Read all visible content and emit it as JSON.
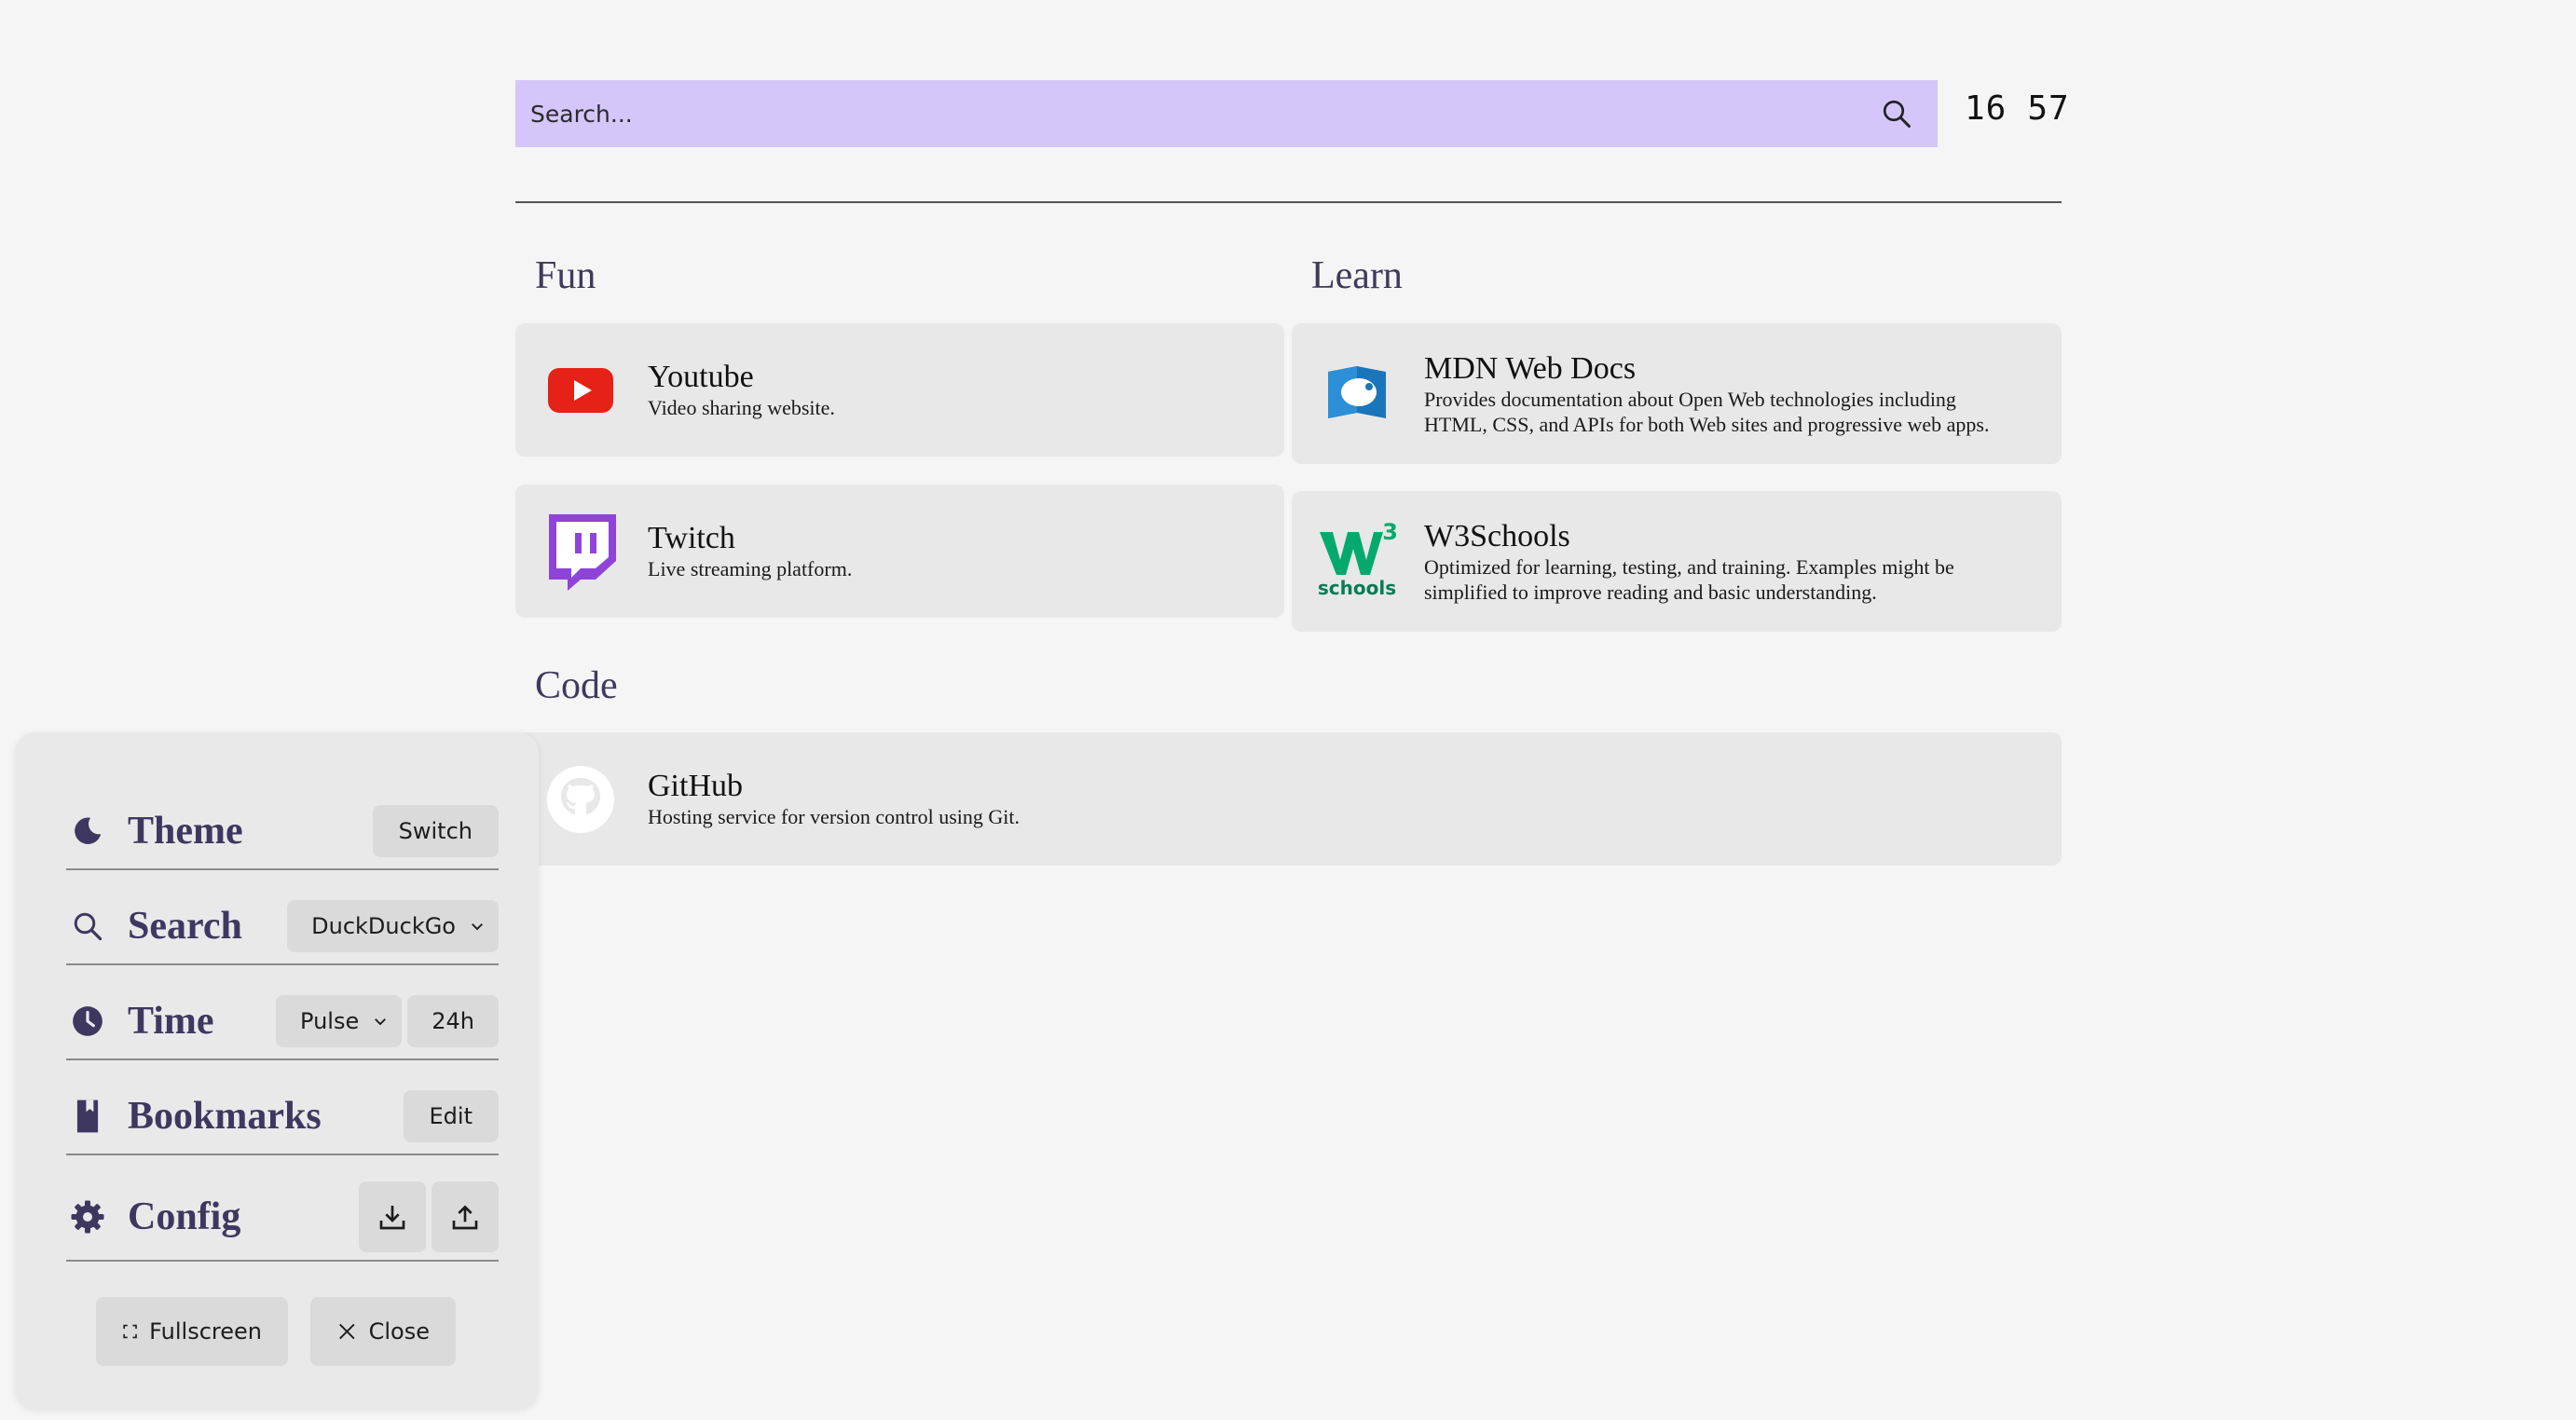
{
  "search": {
    "placeholder": "Search..."
  },
  "clock": {
    "hours": "16",
    "minutes": "57"
  },
  "sections": {
    "fun": {
      "title": "Fun",
      "items": [
        {
          "name": "Youtube",
          "desc": "Video sharing website."
        },
        {
          "name": "Twitch",
          "desc": "Live streaming platform."
        }
      ]
    },
    "learn": {
      "title": "Learn",
      "items": [
        {
          "name": "MDN Web Docs",
          "desc_line1": "Provides documentation about Open Web technologies including",
          "desc_line2": "HTML, CSS, and APIs for both Web sites and progressive web apps."
        },
        {
          "name": "W3Schools",
          "desc_line1": "Optimized for learning, testing, and training. Examples might be",
          "desc_line2": "simplified to improve reading and basic understanding.",
          "logo_text": "schools",
          "logo_sup": "3"
        }
      ]
    },
    "code": {
      "title": "Code",
      "items": [
        {
          "name": "GitHub",
          "desc": "Hosting service for version control using Git."
        }
      ]
    }
  },
  "settings": {
    "theme": {
      "label": "Theme",
      "button": "Switch"
    },
    "search": {
      "label": "Search",
      "engine": "DuckDuckGo"
    },
    "time": {
      "label": "Time",
      "style": "Pulse",
      "format": "24h"
    },
    "bookmarks": {
      "label": "Bookmarks",
      "button": "Edit"
    },
    "config": {
      "label": "Config"
    },
    "fullscreen": "Fullscreen",
    "close": "Close"
  },
  "colors": {
    "accent": "#d4c6fb",
    "label": "#3e3860",
    "youtube": "#e62117",
    "twitch": "#9146ff",
    "mdn": "#1b75bb",
    "w3": "#04aa6d"
  }
}
